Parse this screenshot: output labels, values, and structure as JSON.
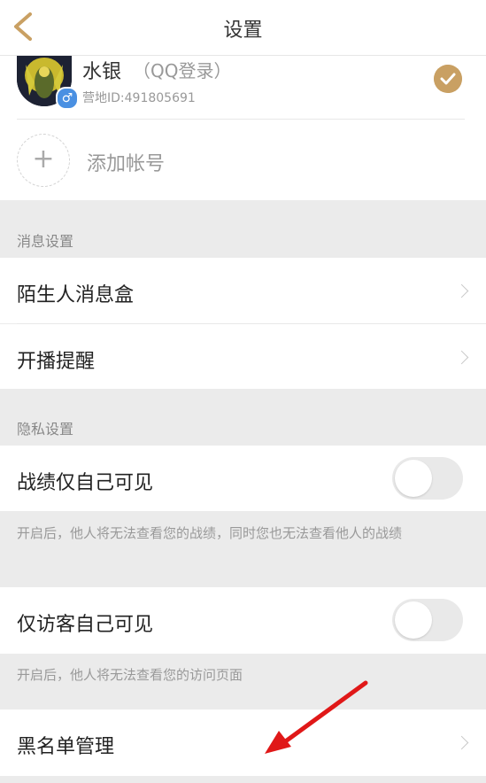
{
  "header": {
    "title": "设置"
  },
  "account": {
    "name": "水银",
    "login_type": "（QQ登录）",
    "id_label": "营地ID:491805691",
    "gender_symbol": "♂"
  },
  "add_account": {
    "plus": "+",
    "label": "添加帐号"
  },
  "sections": {
    "message": {
      "title": "消息设置",
      "items": [
        "陌生人消息盒",
        "开播提醒"
      ]
    },
    "privacy": {
      "title": "隐私设置",
      "record_only_me": {
        "label": "战绩仅自己可见",
        "enabled": false,
        "hint": "开启后，他人将无法查看您的战绩，同时您也无法查看他人的战绩"
      },
      "visitor_only_me": {
        "label": "仅访客自己可见",
        "enabled": false,
        "hint": "开启后，他人将无法查看您的访问页面"
      }
    },
    "blacklist": {
      "label": "黑名单管理"
    }
  },
  "colors": {
    "accent": "#c9a063",
    "annotation_arrow": "#e01818",
    "gender": "#4a90e2"
  },
  "icons": [
    "back-arrow-icon",
    "checkmark-icon",
    "gender-male-icon",
    "plus-icon",
    "chevron-right-icon",
    "toggle-switch"
  ]
}
